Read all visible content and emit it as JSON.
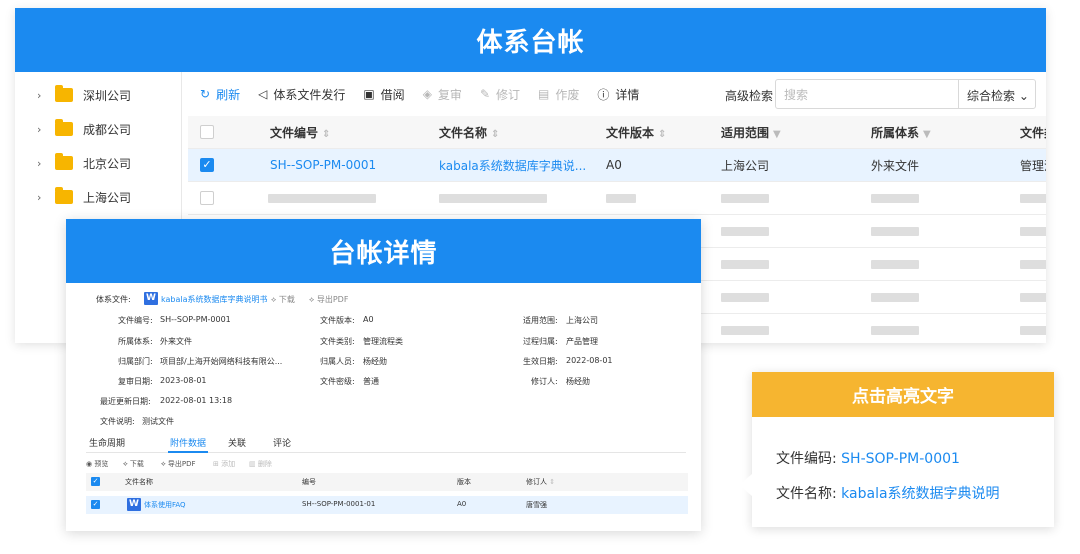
{
  "main": {
    "title": "体系台帐",
    "tree": [
      "深圳公司",
      "成都公司",
      "北京公司",
      "上海公司"
    ],
    "toolbar": {
      "refresh": "刷新",
      "publish": "体系文件发行",
      "borrow": "借阅",
      "review": "复审",
      "revise": "修订",
      "void": "作废",
      "details": "详情"
    },
    "advanced_search": "高级检索",
    "search_placeholder": "搜索",
    "combo_search": "综合检索",
    "columns": [
      "文件编号",
      "文件名称",
      "文件版本",
      "适用范围",
      "所属体系",
      "文件类别"
    ],
    "selected_row": [
      "SH--SOP-PM-0001",
      "kabala系统数据库字典说...",
      "A0",
      "上海公司",
      "外来文件",
      "管理流程"
    ]
  },
  "detail": {
    "title": "台帐详情",
    "doc_label": "体系文件:",
    "doc_name": "kabala系统数据库字典说明书",
    "download": "下载",
    "export_pdf": "导出PDF",
    "fields": {
      "code_label": "文件编号:",
      "code": "SH--SOP-PM-0001",
      "version_label": "文件版本:",
      "version": "A0",
      "scope_label": "适用范围:",
      "scope": "上海公司",
      "system_label": "所属体系:",
      "system": "外来文件",
      "category_label": "文件类别:",
      "category": "管理流程类",
      "process_label": "过程归属:",
      "process": "产品管理",
      "dept_label": "归属部门:",
      "dept": "项目部/上海开始网络科技有限公...",
      "owner_label": "归属人员:",
      "owner": "杨经勋",
      "effective_label": "生效日期:",
      "effective": "2022-08-01",
      "review_label": "复审日期:",
      "review": "2023-08-01",
      "secret_label": "文件密级:",
      "secret": "普通",
      "reviser_label": "修订人:",
      "reviser": "杨经勋",
      "updated_label": "最近更新日期:",
      "updated": "2022-08-01 13:18",
      "desc_label": "文件说明:",
      "desc": "测试文件"
    },
    "tabs": [
      "生命周期",
      "附件数据",
      "关联",
      "评论"
    ],
    "attach_toolbar": [
      "预览",
      "下载",
      "导出PDF",
      "添加",
      "删除"
    ],
    "attach_columns": [
      "文件名称",
      "编号",
      "版本",
      "修订人"
    ],
    "attach_row": [
      "体系使用FAQ",
      "SH--SOP-PM-0001-01",
      "A0",
      "唐雪强"
    ]
  },
  "callout": {
    "title": "点击高亮文字",
    "code_label": "文件编码:",
    "code": "SH-SOP-PM-0001",
    "name_label": "文件名称:",
    "name": "kabala系统数据字典说明"
  },
  "colors": {
    "primary": "#1b8af0",
    "accent": "#f6b530"
  }
}
